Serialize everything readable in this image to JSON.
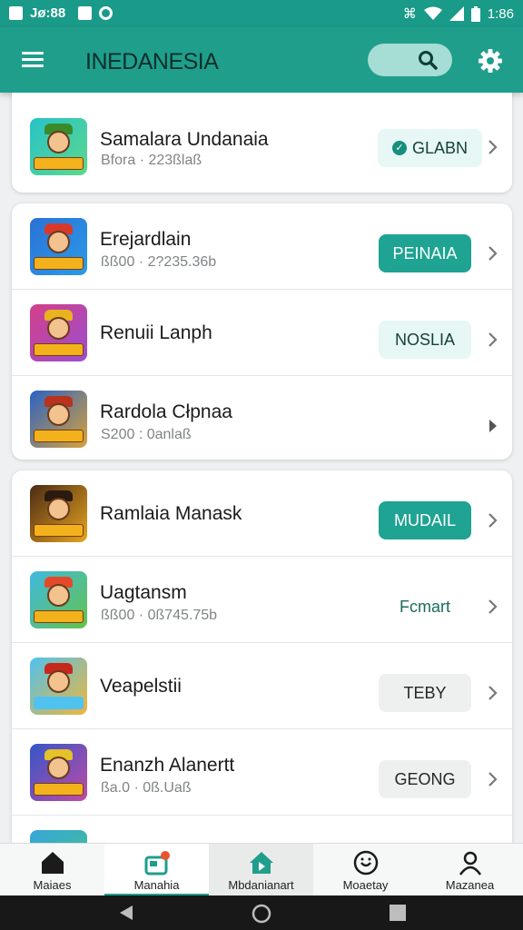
{
  "status_bar": {
    "left_text": "Jø:88",
    "time": "1:86",
    "left_icons": [
      "sim-icon",
      "notification-icon",
      "target-icon"
    ],
    "right_icons": [
      "vibrate-icon",
      "wifi-icon",
      "signal-icon",
      "battery-icon"
    ]
  },
  "app_bar": {
    "title": "INEDANESIA",
    "menu_icon": "hamburger-menu-icon",
    "search_icon": "search-icon",
    "settings_icon": "gear-icon",
    "accent": "#1f9e8c"
  },
  "cards": [
    {
      "rows": [
        {
          "name": "Samalara Undanaia",
          "subtitle": "Bfora · 223ßlaß",
          "chip": "GLABN",
          "chip_style": "light-check",
          "thumb_colors": [
            "#28c3c9",
            "#5cd88a"
          ]
        }
      ]
    },
    {
      "rows": [
        {
          "name": "Erejardlain",
          "subtitle": "ßß00 · 2?235.36b",
          "chip": "PEINAIA",
          "chip_style": "filled",
          "thumb_colors": [
            "#2b72d6",
            "#2b9be8"
          ]
        },
        {
          "name": "Renuii Lanph",
          "subtitle": "",
          "chip": "NOSLIA",
          "chip_style": "light",
          "thumb_colors": [
            "#d43f89",
            "#9b4fd0"
          ]
        },
        {
          "name": "Rardola Cłpnaa",
          "subtitle": "S200 : 0anlaß",
          "chip": "",
          "chip_style": "none",
          "thumb_colors": [
            "#2a62c4",
            "#d8a23a"
          ]
        }
      ]
    },
    {
      "rows": [
        {
          "name": "Ramlaia Manask",
          "subtitle": "",
          "chip": "MUDAIL",
          "chip_style": "filled",
          "thumb_colors": [
            "#4a2a15",
            "#e7a51f"
          ]
        },
        {
          "name": "Uagtansm",
          "subtitle": "ßß00 · 0ß745.75b",
          "chip": "Fcmart",
          "chip_style": "text",
          "thumb_colors": [
            "#3fb9e0",
            "#65c24b"
          ]
        },
        {
          "name": "Veapelstii",
          "subtitle": "",
          "chip": "TEBY",
          "chip_style": "grey",
          "thumb_colors": [
            "#4fc2ef",
            "#f0b53a"
          ]
        },
        {
          "name": "Enanzh Alanertt",
          "subtitle": "ßa.0 · 0ß.Uaß",
          "chip": "GEONG",
          "chip_style": "grey",
          "thumb_colors": [
            "#3457c8",
            "#c04aa6"
          ]
        },
        {
          "name": "",
          "subtitle": "",
          "chip": "",
          "chip_style": "none",
          "thumb_colors": [
            "#38a6d8",
            "#42c08f"
          ]
        }
      ]
    }
  ],
  "bottom_nav": [
    {
      "label": "Maiaes",
      "icon": "home-icon"
    },
    {
      "label": "Manahia",
      "icon": "store-badge-icon"
    },
    {
      "label": "Mbdanianart",
      "icon": "house-play-icon"
    },
    {
      "label": "Moaetay",
      "icon": "smiley-icon"
    },
    {
      "label": "Mazanea",
      "icon": "person-icon"
    }
  ],
  "system_nav": [
    "back-icon",
    "home-circle-icon",
    "recents-icon"
  ]
}
